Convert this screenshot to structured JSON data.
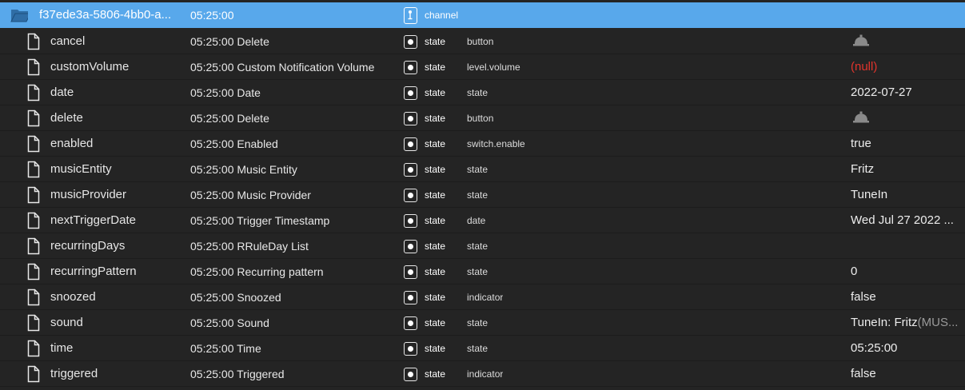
{
  "folder": {
    "name": "f37ede3a-5806-4bb0-a...",
    "time": "05:25:00",
    "type": "channel",
    "icon": "folder-open-icon"
  },
  "colors": {
    "selected_bg": "#58a8eb",
    "background": "#242424",
    "null_value": "#e0342c"
  },
  "rows": [
    {
      "name": "cancel",
      "desc": "05:25:00 Delete",
      "type": "state",
      "role": "button",
      "value": "",
      "value_icon": "bell-icon"
    },
    {
      "name": "customVolume",
      "desc": "05:25:00 Custom Notification Volume",
      "type": "state",
      "role": "level.volume",
      "value": "(null)"
    },
    {
      "name": "date",
      "desc": "05:25:00 Date",
      "type": "state",
      "role": "state",
      "value": "2022-07-27"
    },
    {
      "name": "delete",
      "desc": "05:25:00 Delete",
      "type": "state",
      "role": "button",
      "value": "",
      "value_icon": "bell-icon"
    },
    {
      "name": "enabled",
      "desc": "05:25:00 Enabled",
      "type": "state",
      "role": "switch.enable",
      "value": "true"
    },
    {
      "name": "musicEntity",
      "desc": "05:25:00 Music Entity",
      "type": "state",
      "role": "state",
      "value": "Fritz"
    },
    {
      "name": "musicProvider",
      "desc": "05:25:00 Music Provider",
      "type": "state",
      "role": "state",
      "value": "TuneIn"
    },
    {
      "name": "nextTriggerDate",
      "desc": "05:25:00 Trigger Timestamp",
      "type": "state",
      "role": "date",
      "value": "Wed Jul 27 2022 ..."
    },
    {
      "name": "recurringDays",
      "desc": "05:25:00 RRuleDay List",
      "type": "state",
      "role": "state",
      "value": ""
    },
    {
      "name": "recurringPattern",
      "desc": "05:25:00 Recurring pattern",
      "type": "state",
      "role": "state",
      "value": "0"
    },
    {
      "name": "snoozed",
      "desc": "05:25:00 Snoozed",
      "type": "state",
      "role": "indicator",
      "value": "false"
    },
    {
      "name": "sound",
      "desc": "05:25:00 Sound",
      "type": "state",
      "role": "state",
      "value": "TuneIn: Fritz",
      "value_suffix": "(MUS..."
    },
    {
      "name": "time",
      "desc": "05:25:00 Time",
      "type": "state",
      "role": "state",
      "value": "05:25:00"
    },
    {
      "name": "triggered",
      "desc": "05:25:00 Triggered",
      "type": "state",
      "role": "indicator",
      "value": "false"
    }
  ]
}
